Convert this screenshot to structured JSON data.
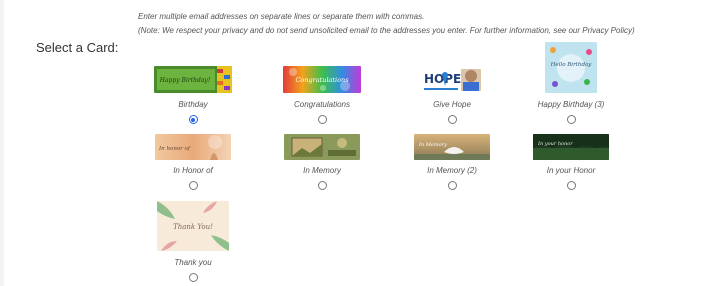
{
  "help": {
    "line1": "Enter multiple email addresses on separate lines or separate them with commas.",
    "line2": "(Note: We respect your privacy and do not send unsolicited email to the addresses you enter. For further information, see our Privacy Policy)"
  },
  "section": {
    "label": "Select a Card:"
  },
  "cards": [
    {
      "caption": "Birthday",
      "thumb_text": "Happy Birthday!",
      "selected": true
    },
    {
      "caption": "Congratulations",
      "thumb_text": "Congratulations",
      "selected": false
    },
    {
      "caption": "Give Hope",
      "thumb_text": "HOPE",
      "selected": false
    },
    {
      "caption": "Happy Birthday (3)",
      "thumb_text": "Hello Birthday",
      "selected": false
    },
    {
      "caption": "In Honor of",
      "thumb_text": "In honor of",
      "selected": false
    },
    {
      "caption": "In Memory",
      "thumb_text": "",
      "selected": false
    },
    {
      "caption": "In Memory (2)",
      "thumb_text": "In Memory",
      "selected": false
    },
    {
      "caption": "In your Honor",
      "thumb_text": "In your honor",
      "selected": false
    },
    {
      "caption": "Thank you",
      "thumb_text": "Thank You!",
      "selected": false
    }
  ],
  "colors": {
    "radio_selected": "#2563eb",
    "panel_bg": "#ffffff",
    "page_bg": "#f3f4f6"
  }
}
